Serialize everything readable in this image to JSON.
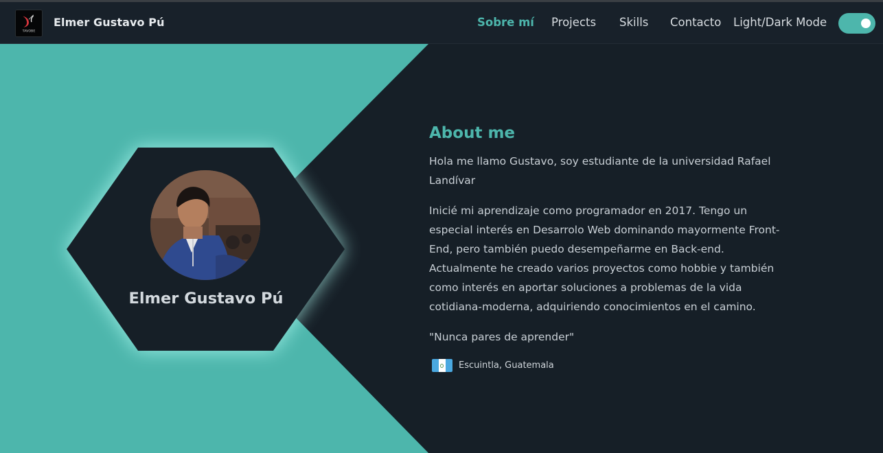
{
  "header": {
    "brand": "Elmer Gustavo Pú",
    "logo_text": "TAVOBE",
    "nav": [
      {
        "label": "Sobre mí",
        "active": true
      },
      {
        "label": "Projects",
        "active": false
      },
      {
        "label": "Skills",
        "active": false
      },
      {
        "label": "Contacto",
        "active": false
      }
    ],
    "mode_label": "Light/Dark Mode",
    "mode_toggle_on": true
  },
  "profile": {
    "name": "Elmer Gustavo Pú"
  },
  "about": {
    "title": "About me",
    "paragraphs": [
      "Hola me llamo Gustavo, soy estudiante de la universidad Rafael Landívar",
      "Inicié mi aprendizaje como programador en 2017. Tengo un especial interés en Desarrolo Web dominando mayormente Front-End, pero también puedo desempeñarme en Back-end. Actualmente he creado varios proyectos como hobbie y también como interés en aportar soluciones a problemas de la vida cotidiana-moderna, adquiriendo conocimientos en el camino."
    ],
    "quote": "\"Nunca pares de aprender\"",
    "location": "Escuintla, Guatemala"
  },
  "colors": {
    "accent": "#4db6ac",
    "background": "#161f27",
    "navbar": "#18212a"
  },
  "icons": {
    "flag": "guatemala-flag-icon",
    "logo": "devil-logo-icon"
  }
}
